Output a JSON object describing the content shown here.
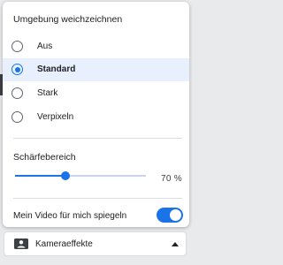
{
  "blur_panel": {
    "title": "Umgebung weichzeichnen",
    "options": [
      {
        "label": "Aus",
        "selected": false
      },
      {
        "label": "Standard",
        "selected": true
      },
      {
        "label": "Stark",
        "selected": false
      },
      {
        "label": "Verpixeln",
        "selected": false
      }
    ]
  },
  "sharpness": {
    "title": "Schärfebereich",
    "value": 70,
    "value_text": "70 %"
  },
  "mirror": {
    "label": "Mein Video für mich spiegeln",
    "enabled": true
  },
  "camera_button": {
    "label": "Kameraeffekte",
    "icon": "camera-effects-icon",
    "caret": "caret-up-icon"
  },
  "colors": {
    "accent": "#1a73e8",
    "selected_bg": "#e8f0fe"
  }
}
